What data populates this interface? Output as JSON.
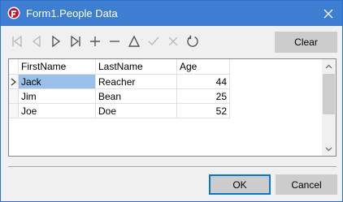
{
  "window": {
    "title": "Form1.People Data"
  },
  "toolbar": {
    "icons": [
      "first-record-icon",
      "previous-record-icon",
      "next-record-icon",
      "last-record-icon",
      "add-icon",
      "delete-icon",
      "edit-icon",
      "post-icon",
      "cancel-edit-icon",
      "refresh-icon"
    ],
    "clear_label": "Clear"
  },
  "grid": {
    "columns": [
      "FirstName",
      "LastName",
      "Age"
    ],
    "rows": [
      {
        "first": "Jack",
        "last": "Reacher",
        "age": "44"
      },
      {
        "first": "Jim",
        "last": "Bean",
        "age": "25"
      },
      {
        "first": "Joe",
        "last": "Doe",
        "age": "52"
      }
    ]
  },
  "footer": {
    "ok_label": "OK",
    "cancel_label": "Cancel"
  },
  "colors": {
    "titlebar": "#3d7dd2",
    "selection": "#99c0ea",
    "focus_border": "#0078d7"
  }
}
